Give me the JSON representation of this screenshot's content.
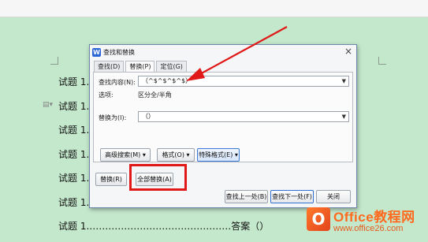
{
  "document": {
    "lines": [
      "试题 1.",
      "试题 1.",
      "试题 1.",
      "试题 1.",
      "试题 1.",
      "试题 1.",
      "试题 1.………………………………………答案（）"
    ]
  },
  "dialog": {
    "title": "查找和替换",
    "close_label": "×",
    "tabs": [
      {
        "label": "查找(D)"
      },
      {
        "label": "替换(P)"
      },
      {
        "label": "定位(G)"
      }
    ],
    "find_label": "查找内容(N):",
    "find_value": "（^$^$^$^$）",
    "options_label": "选项:",
    "options_value": "区分全/半角",
    "replace_label": "替换为(I):",
    "replace_value": "（）",
    "advanced_search_button": "高级搜索(M) ▾",
    "format_button": "格式(O) ▾",
    "special_format_button": "特殊格式(E) ▾",
    "replace_button": "替换(R)",
    "replace_all_button": "全部替换(A)",
    "find_prev_button": "查找上一处(B)",
    "find_next_button": "查找下一处(F)",
    "close_button": "关闭"
  },
  "watermark": {
    "name": "Office教程网",
    "url": "www.office26.com"
  },
  "colors": {
    "background": "#c4e8cc",
    "highlight": "#e01818",
    "brand": "#ff6a1f"
  }
}
